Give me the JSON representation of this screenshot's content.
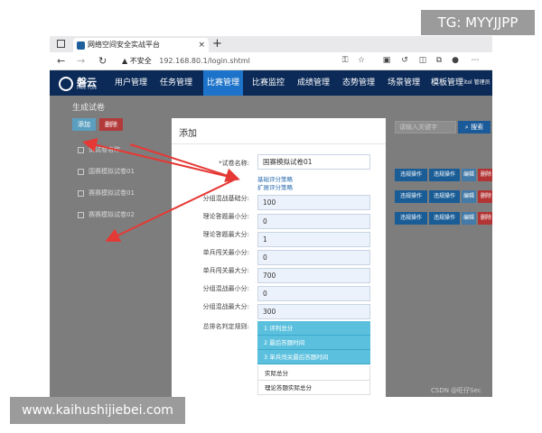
{
  "watermarks": {
    "top": "TG: MYYJJPP",
    "bottom": "www.kaihushijiebei.com"
  },
  "browser": {
    "tab_title": "网络空间安全实战平台",
    "tab_close": "×",
    "new_tab": "+",
    "security_warning": "不安全",
    "url": "192.168.80.1/login.shtml"
  },
  "app": {
    "logo_name": "磐云",
    "logo_sub": "PAN YUN",
    "nav": [
      "用户管理",
      "任务管理",
      "比赛管理",
      "比赛监控",
      "成绩管理",
      "态势管理",
      "场景管理",
      "模板管理"
    ],
    "nav_extra": "itol 管理员",
    "active_nav": "比赛管理"
  },
  "page": {
    "title": "生成试卷",
    "add_button": "添加",
    "delete_button": "删除",
    "search_placeholder": "请输入关键字",
    "search_button": "搜索",
    "table_header": "试试卷名称",
    "rows": [
      "国赛模拟试卷01",
      "赛赛模拟试卷01",
      "赛赛模拟试卷02"
    ],
    "row_actions": [
      "违规操作",
      "违规操作",
      "编辑",
      "删除"
    ],
    "copyright": "CSDN @旺仔Sec"
  },
  "modal": {
    "title": "添加",
    "fields": [
      {
        "label": "*试卷名称:",
        "value": "国赛模拟试卷01"
      },
      {
        "label": "分组混战基础分:",
        "value": "100"
      },
      {
        "label": "理论答题最小分:",
        "value": "0"
      },
      {
        "label": "理论答题最大分:",
        "value": "1"
      },
      {
        "label": "单兵闯关最小分:",
        "value": "0"
      },
      {
        "label": "单兵闯关最大分:",
        "value": "700"
      },
      {
        "label": "分组混战最小分:",
        "value": "0"
      },
      {
        "label": "分组混战最大分:",
        "value": "300"
      }
    ],
    "links": [
      "基础评分策略",
      "扩展评分策略"
    ],
    "rank_rule_label": "总排名判定规则:",
    "rank_options_selected": [
      "1 评判总分",
      "2 最后答题时间",
      "3 单兵闯关最后答题时间"
    ],
    "rank_options_rest": [
      "实际总分",
      "理论答题实际总分"
    ]
  },
  "colors": {
    "nav_bg": "#0b2a57",
    "nav_active": "#1d73c9",
    "arrow": "#e53935",
    "option_selected": "#5bc0de"
  }
}
